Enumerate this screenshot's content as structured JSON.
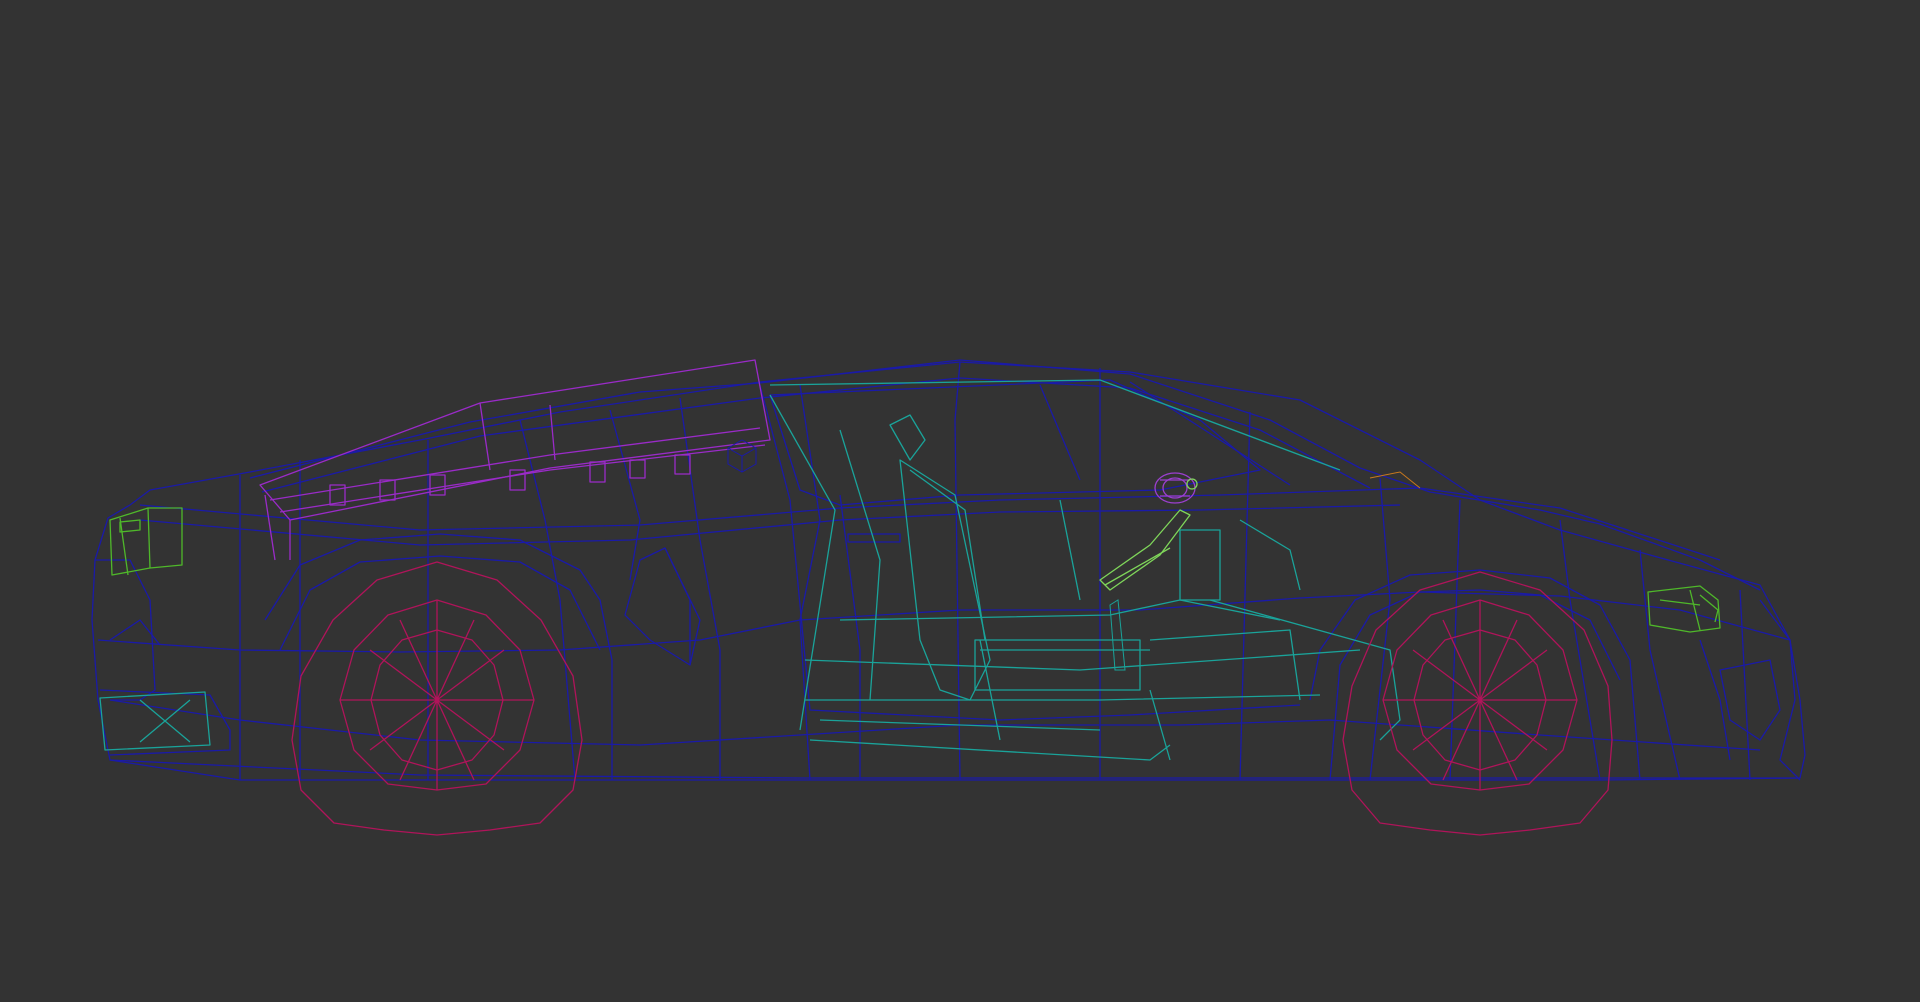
{
  "viewport": {
    "view": "side-orthographic",
    "render_mode": "wireframe",
    "background_color": "#333333"
  },
  "colors": {
    "body": "#1a1aa8",
    "interior": "#1aa39a",
    "windshield_frame": "#9a2bc8",
    "wheels": "#b0145a",
    "lights": "#4fb82a",
    "steering": "#7fd65a",
    "mirror": "#9b3fd0",
    "accent": "#c8781e"
  },
  "objects": [
    {
      "name": "car-body",
      "color_key": "body"
    },
    {
      "name": "door-panel",
      "color_key": "body"
    },
    {
      "name": "interior-cabin",
      "color_key": "interior"
    },
    {
      "name": "seat",
      "color_key": "interior"
    },
    {
      "name": "roof-rail",
      "color_key": "windshield_frame"
    },
    {
      "name": "front-wheel",
      "color_key": "wheels"
    },
    {
      "name": "rear-wheel",
      "color_key": "wheels"
    },
    {
      "name": "headlight",
      "color_key": "lights"
    },
    {
      "name": "taillight",
      "color_key": "lights"
    },
    {
      "name": "steering-column",
      "color_key": "steering"
    },
    {
      "name": "side-mirror",
      "color_key": "mirror"
    }
  ]
}
